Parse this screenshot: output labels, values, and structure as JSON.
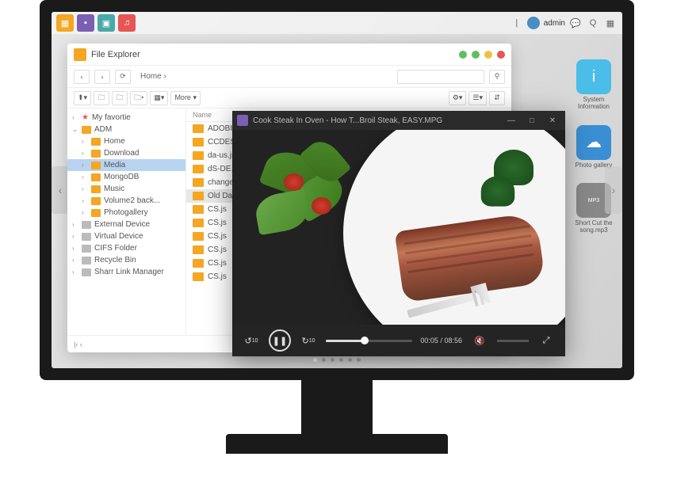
{
  "taskbar": {
    "user_label": "admin"
  },
  "desktop": {
    "icons": [
      {
        "label": "System Information"
      },
      {
        "label": "Photo gallery"
      },
      {
        "label": "Short Cut the song.mp3"
      }
    ],
    "mp3_badge": "MP3"
  },
  "file_explorer": {
    "title": "File Explorer",
    "breadcrumb": "Home  ›",
    "more_label": "More ▾",
    "tree": {
      "favortie": "My favortie",
      "adm": "ADM",
      "home": "Home",
      "download": "Download",
      "media": "Media",
      "mongodb": "MongoDB",
      "music": "Music",
      "volume2": "Volume2 back...",
      "photogallery": "Photogallery",
      "external": "External Device",
      "virtual": "Virtual Device",
      "cifs": "CIFS Folder",
      "recycle": "Recycle Bin",
      "sharr": "Sharr Link Manager"
    },
    "list_header": "Name",
    "files": [
      "ADOBIKD",
      "CCDES26",
      "da-us.js",
      "dS-DE.js",
      "change fo",
      "Old Data",
      "CS.js",
      "CS.js",
      "CS.js",
      "CS.js",
      "CS.js",
      "CS.js"
    ],
    "pager": "|‹  ‹"
  },
  "video_player": {
    "title": "Cook Steak In Oven - How T...Broil Steak, EASY.MPG",
    "skip_back": "10",
    "skip_fwd": "10",
    "time_current": "00:05",
    "time_sep": "/",
    "time_total": "08:56",
    "progress_pct": 45
  }
}
